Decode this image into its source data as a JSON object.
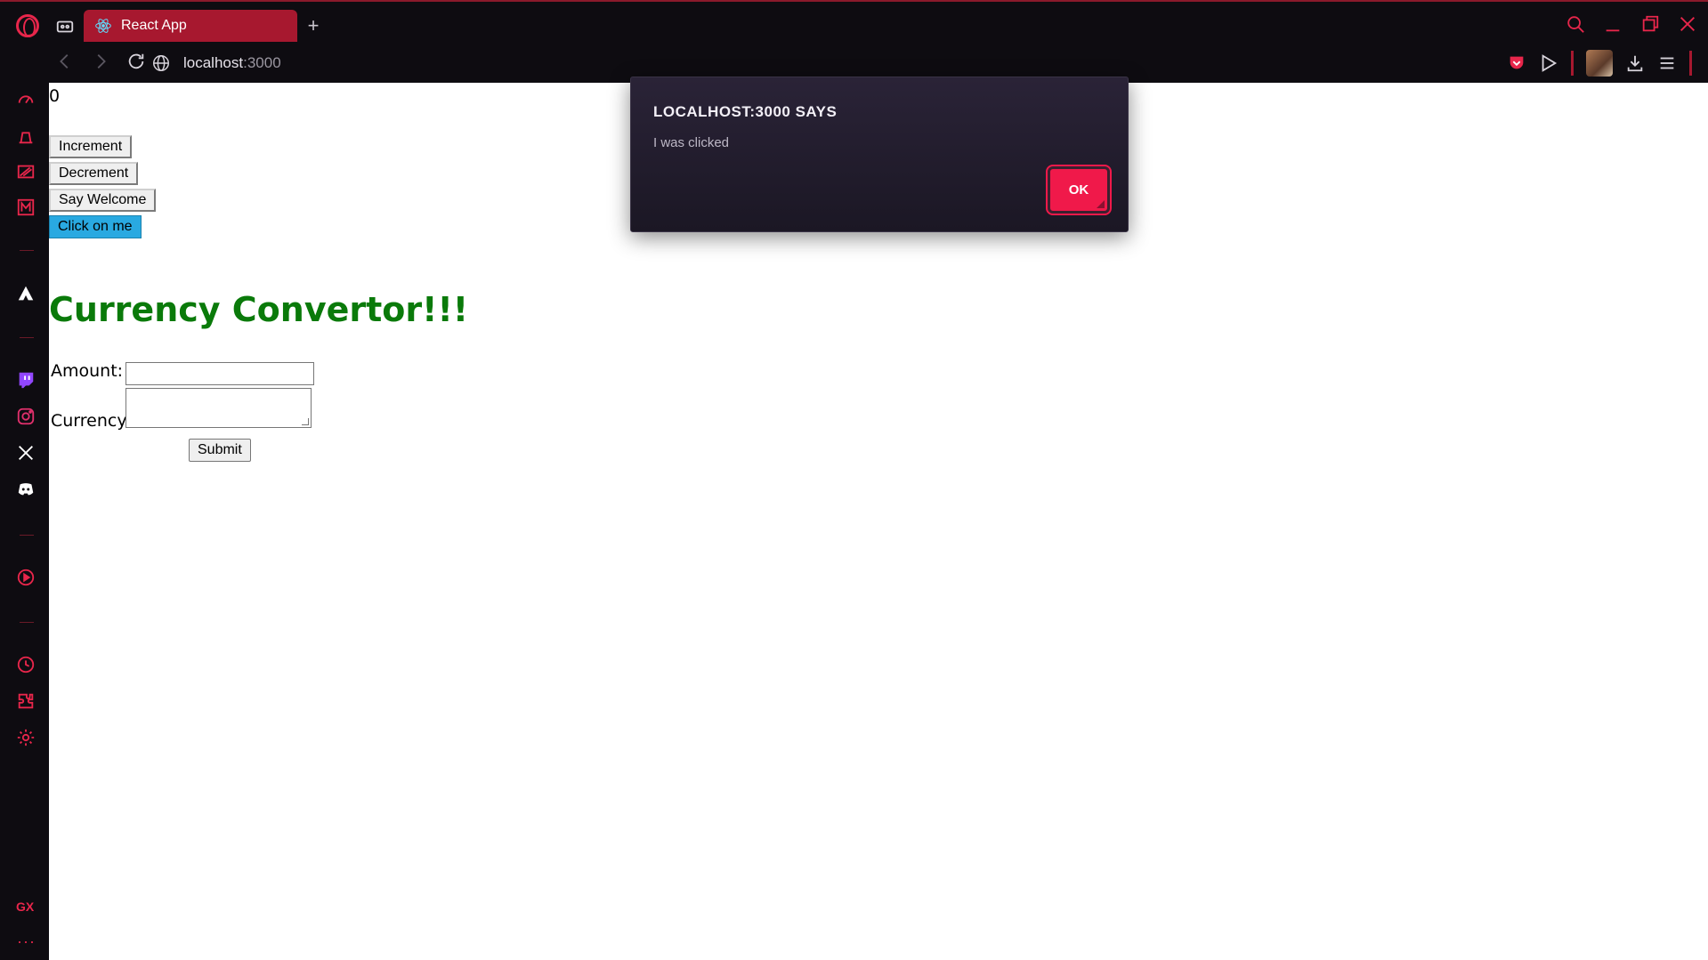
{
  "browser": {
    "tab_title": "React App",
    "url_host": "localhost",
    "url_port": ":3000"
  },
  "page": {
    "counter": "0",
    "buttons": {
      "increment": "Increment",
      "decrement": "Decrement",
      "say_welcome": "Say Welcome",
      "click_me": "Click on me"
    },
    "heading": "Currency Convertor!!!",
    "form": {
      "amount_label": "Amount:",
      "amount_value": "",
      "currency_label": "Currency:",
      "currency_value": "",
      "submit_label": "Submit"
    }
  },
  "dialog": {
    "title": "LOCALHOST:3000 SAYS",
    "message": "I was clicked",
    "ok_label": "OK"
  },
  "sidebar": {
    "gx_label": "GX",
    "more_label": "···"
  },
  "colors": {
    "accent": "#e8264b",
    "tab_active": "#a7182f",
    "heading_green": "#0a7a0a",
    "click_button_blue": "#29a9e1",
    "dialog_bg": "#221c2d"
  }
}
